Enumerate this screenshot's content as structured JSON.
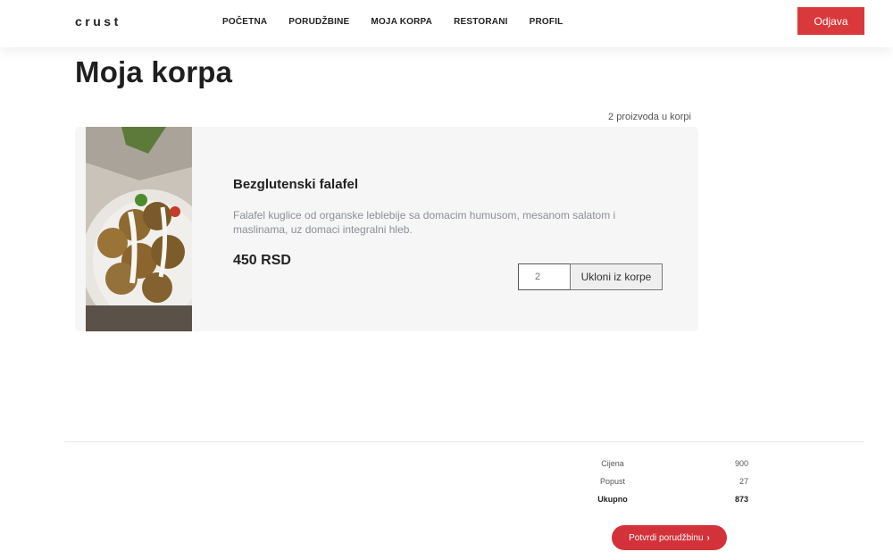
{
  "brand": "crust",
  "nav": {
    "items": [
      {
        "label": "POČETNA"
      },
      {
        "label": "PORUDŽBINE"
      },
      {
        "label": "MOJA KORPA"
      },
      {
        "label": "RESTORANI"
      },
      {
        "label": "PROFIL"
      }
    ],
    "logout_label": "Odjava"
  },
  "page": {
    "title": "Moja korpa",
    "count_text": "2 proizvoda u korpi"
  },
  "cart": {
    "items": [
      {
        "name": "Bezglutenski falafel",
        "description": "Falafel kuglice od organske leblebije sa domacim humusom, mesanom salatom i maslinama, uz domaci integralni hleb.",
        "price": "450 RSD",
        "quantity": "2",
        "remove_label": "Ukloni iz korpe",
        "image_icon": "falafel-photo"
      }
    ]
  },
  "summary": {
    "rows": [
      {
        "label": "Cijena",
        "value": "900"
      },
      {
        "label": "Popust",
        "value": "27"
      },
      {
        "label": "Ukupno",
        "value": "873"
      }
    ],
    "confirm_label": "Potvrdi porudžbinu",
    "confirm_icon": "chevron-right-icon"
  },
  "colors": {
    "accent": "#d9393b",
    "card_bg": "#f6f6f6"
  }
}
